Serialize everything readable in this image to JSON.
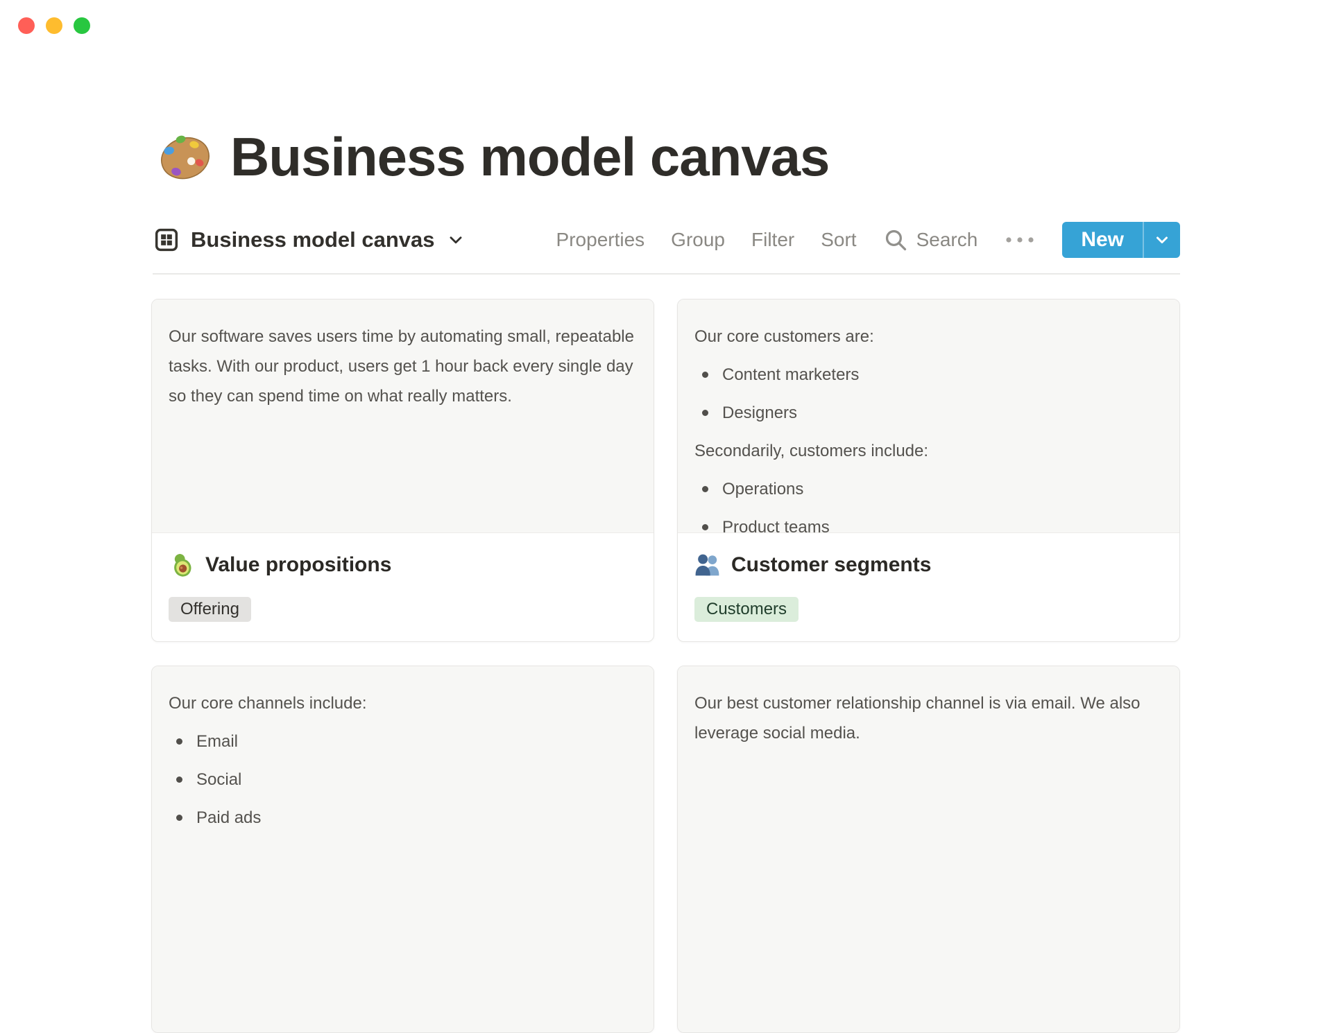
{
  "window": {
    "controls": [
      "close",
      "minimize",
      "zoom"
    ]
  },
  "page": {
    "icon": "palette-emoji",
    "title": "Business model canvas"
  },
  "toolbar": {
    "view": {
      "icon": "gallery-grid-icon",
      "name": "Business model canvas"
    },
    "menu": {
      "properties": "Properties",
      "group": "Group",
      "filter": "Filter",
      "sort": "Sort"
    },
    "search": {
      "icon": "search-icon",
      "label": "Search"
    },
    "more_icon": "ellipsis-icon",
    "new_button": {
      "label": "New",
      "bg": "#36A3D6"
    }
  },
  "board": {
    "cards": [
      {
        "blocks": [
          {
            "text": "Our software saves users time by automating small, repeatable tasks. With our product, users get 1 hour back every single day so they can spend time on what really matters."
          }
        ],
        "footer": {
          "icon": "avocado-emoji",
          "title": "Value propositions",
          "tag": {
            "label": "Offering",
            "bg": "#E3E2E0",
            "color": "#32302C"
          }
        }
      },
      {
        "blocks": [
          {
            "text": "Our core customers are:"
          },
          {
            "bullet": true,
            "text": "Content marketers"
          },
          {
            "bullet": true,
            "text": "Designers"
          },
          {
            "text": "Secondarily, customers include:"
          },
          {
            "bullet": true,
            "text": "Operations"
          },
          {
            "bullet": true,
            "text": "Product teams"
          }
        ],
        "footer": {
          "icon": "people-emoji",
          "title": "Customer segments",
          "tag": {
            "label": "Customers",
            "bg": "#DBEDDB",
            "color": "#1F3D2B"
          }
        }
      },
      {
        "blocks": [
          {
            "text": "Our core channels include:"
          },
          {
            "bullet": true,
            "text": "Email"
          },
          {
            "bullet": true,
            "text": "Social"
          },
          {
            "bullet": true,
            "text": "Paid ads"
          }
        ]
      },
      {
        "blocks": [
          {
            "text": "Our best customer relationship channel is via email. We also leverage social media."
          }
        ]
      }
    ]
  }
}
